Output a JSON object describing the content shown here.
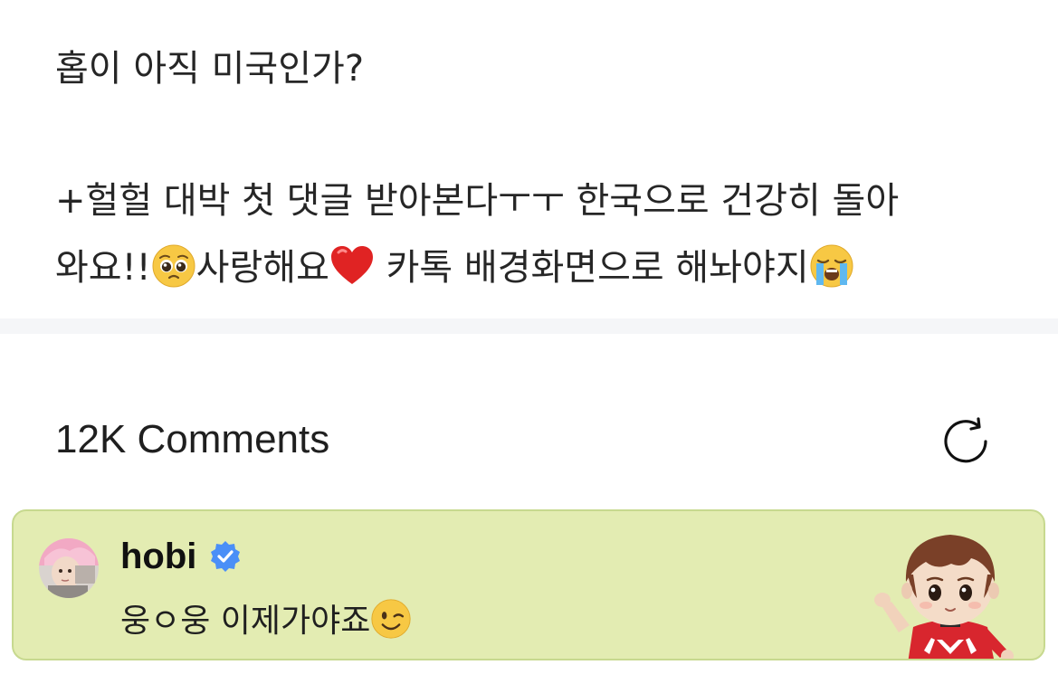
{
  "post": {
    "line1": "홉이 아직 미국인가?",
    "line2": "+헐헐 대박 첫 댓글 받아본다ㅜㅜ 한국으로 건강히 돌아",
    "line3_a": "와요!!",
    "line3_b": "사랑해요",
    "line3_c": " 카톡 배경화면으로 해놔야지",
    "emojis": [
      "pleading-face-icon",
      "red-heart-icon",
      "loudly-crying-face-icon"
    ]
  },
  "comments": {
    "count_label": "12K Comments",
    "refresh_icon": "refresh-icon"
  },
  "artist_comment": {
    "author": "hobi",
    "verified": true,
    "text": "웅ㅇ웅 이제가야죠",
    "emoji": "winking-face-icon",
    "background": "#e3ecb2",
    "border": "#c7d98f",
    "verified_color": "#4a8ff7"
  }
}
